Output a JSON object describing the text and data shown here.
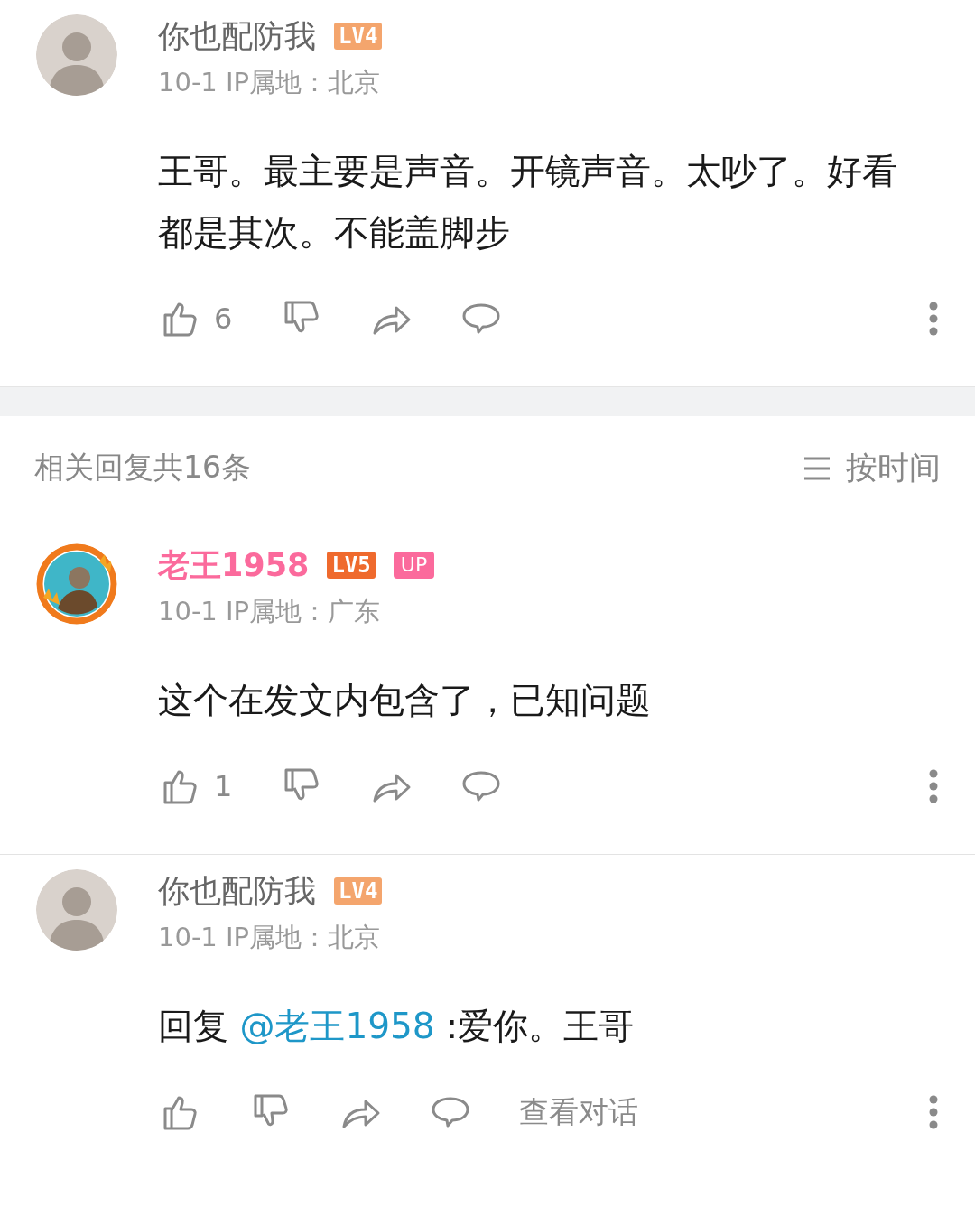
{
  "main_comment": {
    "name": "你也配防我",
    "vip": false,
    "framed": false,
    "level": "LV4",
    "color": "#f4a56d",
    "meta": "10-1 IP属地：北京",
    "body": [
      {
        "kind": "text",
        "text": "王哥。最主要是声音。开镜声音。太吵了。好看都是其次。不能盖脚步"
      }
    ],
    "likes": "6"
  },
  "replies_header": {
    "count": "相关回复共16条",
    "sort": "按时间"
  },
  "replies": [
    {
      "name": "老王1958",
      "vip": true,
      "framed": true,
      "level": "LV5",
      "color": "#ef6a2d",
      "badge": "UP",
      "meta": "10-1 IP属地：广东",
      "body": [
        {
          "kind": "text",
          "text": "这个在发文内包含了，已知问题"
        }
      ],
      "likes": "1"
    },
    {
      "name": "你也配防我",
      "vip": false,
      "framed": false,
      "level": "LV4",
      "color": "#f4a56d",
      "meta": "10-1 IP属地：北京",
      "body": [
        {
          "kind": "text",
          "text": "回复 "
        },
        {
          "kind": "mention",
          "text": "@老王1958"
        },
        {
          "kind": "text",
          "text": " :爱你。王哥"
        }
      ],
      "view_dialog": "查看对话"
    }
  ]
}
